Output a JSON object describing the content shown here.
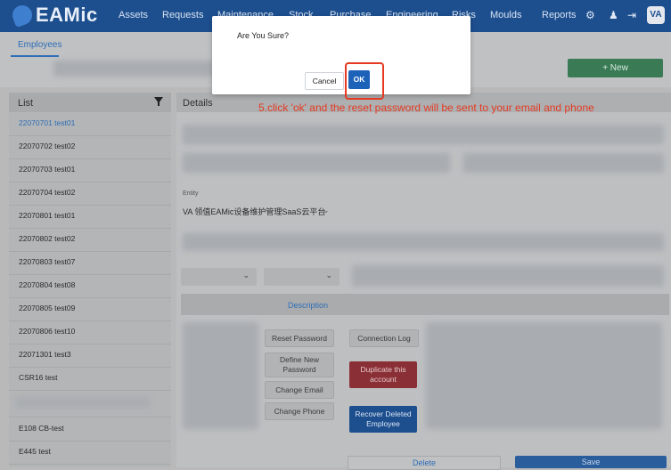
{
  "app": {
    "logo_text": "EAMic",
    "nav": [
      "Assets",
      "Requests",
      "Maintenance",
      "Stock",
      "Purchase",
      "Engineering",
      "Risks",
      "Moulds",
      "Reports"
    ],
    "avatar_text": "VA"
  },
  "subheader": {
    "tab": "Employees",
    "new_button": "+ New"
  },
  "list": {
    "title": "List",
    "items": [
      "22070701 test01",
      "22070702 test02",
      "22070703 test01",
      "22070704 test02",
      "22070801 test01",
      "22070802 test02",
      "22070803 test07",
      "22070804 test08",
      "22070805 test09",
      "22070806 test10",
      "22071301 test3",
      "CSR16 test",
      "",
      "E108 CB-test",
      "E445 test"
    ],
    "active_index": 0
  },
  "details": {
    "title": "Details",
    "entity_label": "Entity",
    "entity_value": "VA 领值EAMic设备维护管理SaaS云平台",
    "description_label": "Description",
    "actions": {
      "reset_password": "Reset Password",
      "define_new_password": "Define New Password",
      "change_email": "Change Email",
      "change_phone": "Change Phone",
      "connection_log": "Connection Log",
      "duplicate_account": "Duplicate this account",
      "recover_deleted": "Recover Deleted Employee"
    },
    "footer": {
      "delete": "Delete",
      "save": "Save"
    }
  },
  "modal": {
    "title": "Are You Sure?",
    "cancel": "Cancel",
    "ok": "OK"
  },
  "annotation": {
    "text": "5.click 'ok' and the reset password will be sent to your email and phone",
    "color": "#e53920"
  },
  "colors": {
    "brand": "#1d4f8f",
    "ok_button": "#1b62b8",
    "new_button": "#3a7b56",
    "duplicate_button": "#8a2f36"
  }
}
